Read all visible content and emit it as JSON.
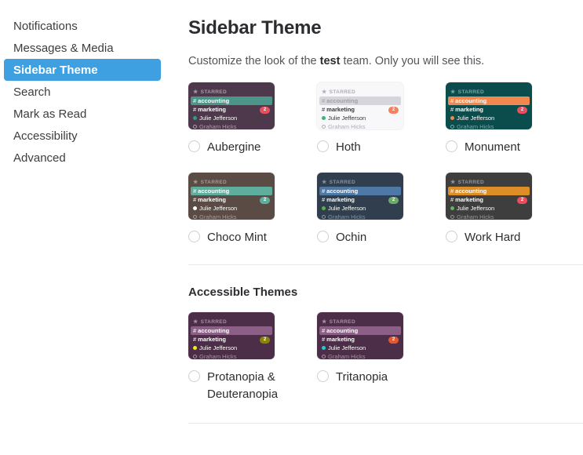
{
  "sidebar": {
    "items": [
      {
        "label": "Notifications",
        "active": false
      },
      {
        "label": "Messages & Media",
        "active": false
      },
      {
        "label": "Sidebar Theme",
        "active": true
      },
      {
        "label": "Search",
        "active": false
      },
      {
        "label": "Mark as Read",
        "active": false
      },
      {
        "label": "Accessibility",
        "active": false
      },
      {
        "label": "Advanced",
        "active": false
      }
    ],
    "active_bg": "#3ea0e0"
  },
  "main": {
    "title": "Sidebar Theme",
    "description_prefix": "Customize the look of the ",
    "description_team": "test",
    "description_suffix": " team. Only you will see this.",
    "accessible_section_title": "Accessible Themes"
  },
  "preview_labels": {
    "starred": "STARRED",
    "hash": "#",
    "channel_active": "accounting",
    "channel_unread": "marketing",
    "badge_count": "2",
    "dm_online": "Julie Jefferson",
    "dm_offline": "Graham Hicks"
  },
  "themes": [
    {
      "name": "Aubergine",
      "selected": false,
      "colors": {
        "bg": "#4d394b",
        "text_dim": "#ab9ba9",
        "text_bright": "#ffffff",
        "active_bg": "#4c9689",
        "active_text": "#ffffff",
        "badge_bg": "#eb4d5c",
        "badge_text": "#ffffff",
        "presence": "#38978d"
      }
    },
    {
      "name": "Hoth",
      "selected": false,
      "colors": {
        "bg": "#f8f8fa",
        "text_dim": "#aeaeb6",
        "text_bright": "#36363c",
        "active_bg": "#d5d6db",
        "active_text": "#a0a0a8",
        "badge_bg": "#f5815e",
        "badge_text": "#ffffff",
        "presence": "#3fb27f"
      }
    },
    {
      "name": "Monument",
      "selected": false,
      "colors": {
        "bg": "#0b4c4c",
        "text_dim": "#7aa6a6",
        "text_bright": "#ffffff",
        "active_bg": "#f2884f",
        "active_text": "#ffffff",
        "badge_bg": "#eb4d5c",
        "badge_text": "#ffffff",
        "presence": "#f2884f"
      }
    },
    {
      "name": "Choco Mint",
      "selected": false,
      "colors": {
        "bg": "#5a4b45",
        "text_dim": "#a99a92",
        "text_bright": "#ffffff",
        "active_bg": "#5fae9d",
        "active_text": "#ffffff",
        "badge_bg": "#5fae9d",
        "badge_text": "#ffffff",
        "presence": "#ffffff"
      }
    },
    {
      "name": "Ochin",
      "selected": false,
      "colors": {
        "bg": "#303e4d",
        "text_dim": "#8494a6",
        "text_bright": "#ffffff",
        "active_bg": "#4e79a7",
        "active_text": "#ffffff",
        "badge_bg": "#6ba96b",
        "badge_text": "#ffffff",
        "presence": "#5fae4e"
      }
    },
    {
      "name": "Work Hard",
      "selected": false,
      "colors": {
        "bg": "#3e3e3e",
        "text_dim": "#969696",
        "text_bright": "#ffffff",
        "active_bg": "#dd8e26",
        "active_text": "#ffffff",
        "badge_bg": "#eb4d5c",
        "badge_text": "#ffffff",
        "presence": "#63b463"
      }
    }
  ],
  "accessible_themes": [
    {
      "name": "Protanopia & Deuteranopia",
      "selected": false,
      "colors": {
        "bg": "#4d2e48",
        "text_dim": "#a98fa3",
        "text_bright": "#ffffff",
        "active_bg": "#8b5f86",
        "active_text": "#ffffff",
        "badge_bg": "#8a8500",
        "badge_text": "#ffffff",
        "presence": "#eeee22"
      }
    },
    {
      "name": "Tritanopia",
      "selected": false,
      "colors": {
        "bg": "#4d2e48",
        "text_dim": "#a98fa3",
        "text_bright": "#ffffff",
        "active_bg": "#8b5f86",
        "active_text": "#ffffff",
        "badge_bg": "#e8562b",
        "badge_text": "#ffffff",
        "presence": "#22cccc"
      }
    }
  ]
}
